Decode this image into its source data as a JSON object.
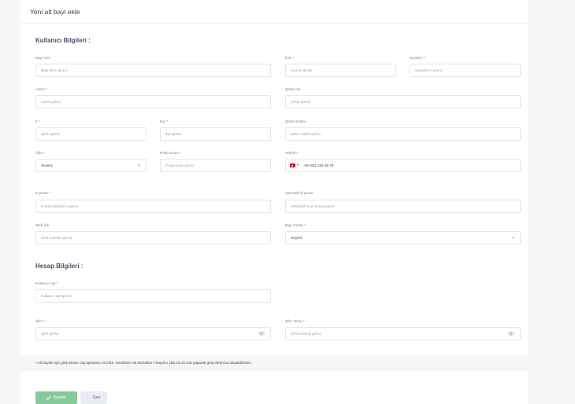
{
  "header": {
    "title": "Yeni alt bayi ekle"
  },
  "user_section": {
    "title": "Kullanıcı Bilgileri :",
    "dealer_name": {
      "label": "Bayi Adı *",
      "placeholder": "Bayi adını giriniz"
    },
    "first_name": {
      "label": "İsim *",
      "placeholder": "Adınızı giriniz"
    },
    "last_name": {
      "label": "Soyisim *",
      "placeholder": "Soyadınızı giriniz"
    },
    "address": {
      "label": "Adres *",
      "placeholder": "Adres giriniz"
    },
    "company_name": {
      "label": "Şirket Adı",
      "placeholder": "Şirket giriniz"
    },
    "city": {
      "label": "İl *",
      "placeholder": "Şehir giriniz"
    },
    "district": {
      "label": "İlçe *",
      "placeholder": "İlçe giriniz"
    },
    "company_owner": {
      "label": "Şirket Sahibi",
      "placeholder": "Şirket sahibi giriniz"
    },
    "country": {
      "label": "Ülke *",
      "value": "Seçiniz"
    },
    "postal_code": {
      "label": "Posta Kodu *",
      "placeholder": "Posta kodu giriniz"
    },
    "phone": {
      "label": "Telefon *",
      "value": "+90 501 234 56 78",
      "flag_icon": "turkey-flag-icon",
      "flag_color": "#c8102e"
    },
    "email": {
      "label": "E-posta *",
      "placeholder": "E-mail adresinizi giriniz"
    },
    "alt_email": {
      "label": "Alternatif E-posta",
      "placeholder": "Alternatif mail adresi giriniz"
    },
    "website": {
      "label": "Web link",
      "placeholder": "Web adresini giriniz"
    },
    "dealer_group": {
      "label": "Bayi Grubu *",
      "value": "Seçiniz"
    }
  },
  "account_section": {
    "title": "Hesap Bilgileri :",
    "username": {
      "label": "Kullanıcı Adı *",
      "placeholder": "Kullanıcı adı giriniz"
    },
    "password": {
      "label": "Şifre *",
      "placeholder": "Şifre giriniz"
    },
    "password_confirm": {
      "label": "Şifre Onay *",
      "placeholder": "Şifreyi tekrar giriniz"
    }
  },
  "notice": {
    "text": "• Alt bayiler için giriş ekranı csp.apiname.com'dur. Kendinize ait domainin A kaydını 185.46.43.245 yaparak giriş ekranına ulaşabilirsiniz."
  },
  "buttons": {
    "save": "Kaydet",
    "back": "Geri",
    "save_icon": "check-icon",
    "back_icon": "arrow-left-icon",
    "save_color": "#86c99a"
  }
}
